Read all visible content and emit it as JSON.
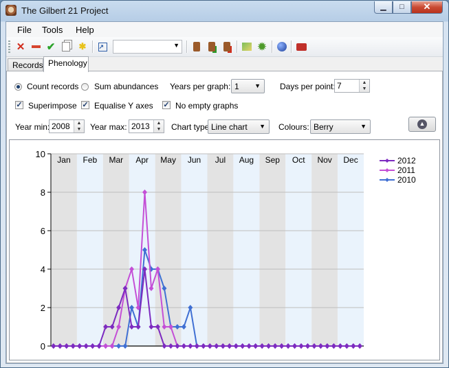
{
  "window": {
    "title": "The Gilbert 21 Project"
  },
  "menu": [
    "File",
    "Tools",
    "Help"
  ],
  "tabs": [
    {
      "label": "Records",
      "active": false
    },
    {
      "label": "Phenology",
      "active": true
    }
  ],
  "options": {
    "radios": [
      {
        "label": "Count records",
        "checked": true
      },
      {
        "label": "Sum abundances",
        "checked": false
      }
    ],
    "years_per_graph_label": "Years per graph:",
    "years_per_graph": "1",
    "days_per_point_label": "Days per point:",
    "days_per_point": "7",
    "checkboxes": [
      {
        "label": "Superimpose",
        "checked": true
      },
      {
        "label": "Equalise Y axes",
        "checked": true
      },
      {
        "label": "No empty graphs",
        "checked": true
      }
    ],
    "year_min_label": "Year min:",
    "year_min": "2008",
    "year_max_label": "Year max:",
    "year_max": "2013",
    "chart_type_label": "Chart type:",
    "chart_type": "Line chart",
    "colours_label": "Colours:",
    "colours": "Berry"
  },
  "chart_data": {
    "type": "line",
    "categories": [
      "Jan",
      "Feb",
      "Mar",
      "Apr",
      "May",
      "Jun",
      "Jul",
      "Aug",
      "Sep",
      "Oct",
      "Nov",
      "Dec"
    ],
    "ylim": [
      0,
      10
    ],
    "yticks": [
      0,
      2,
      4,
      6,
      8,
      10
    ],
    "xlim": [
      0,
      12
    ],
    "legend_position": "top-right",
    "series": [
      {
        "name": "2012",
        "color": "#7d2bc0",
        "points": [
          [
            0.1,
            0
          ],
          [
            0.35,
            0
          ],
          [
            0.6,
            0
          ],
          [
            0.85,
            0
          ],
          [
            1.1,
            0
          ],
          [
            1.35,
            0
          ],
          [
            1.6,
            0
          ],
          [
            1.85,
            0
          ],
          [
            2.1,
            1
          ],
          [
            2.35,
            1
          ],
          [
            2.6,
            2
          ],
          [
            2.85,
            3
          ],
          [
            3.1,
            1
          ],
          [
            3.35,
            1
          ],
          [
            3.6,
            4
          ],
          [
            3.85,
            1
          ],
          [
            4.1,
            1
          ],
          [
            4.35,
            0
          ],
          [
            4.6,
            0
          ],
          [
            4.85,
            0
          ],
          [
            5.1,
            0
          ],
          [
            5.35,
            0
          ],
          [
            5.6,
            0
          ],
          [
            5.85,
            0
          ],
          [
            6.1,
            0
          ],
          [
            6.35,
            0
          ],
          [
            6.6,
            0
          ],
          [
            6.85,
            0
          ],
          [
            7.1,
            0
          ],
          [
            7.35,
            0
          ],
          [
            7.6,
            0
          ],
          [
            7.85,
            0
          ],
          [
            8.1,
            0
          ],
          [
            8.35,
            0
          ],
          [
            8.6,
            0
          ],
          [
            8.85,
            0
          ],
          [
            9.1,
            0
          ],
          [
            9.35,
            0
          ],
          [
            9.6,
            0
          ],
          [
            9.85,
            0
          ],
          [
            10.1,
            0
          ],
          [
            10.35,
            0
          ],
          [
            10.6,
            0
          ],
          [
            10.85,
            0
          ],
          [
            11.1,
            0
          ],
          [
            11.35,
            0
          ],
          [
            11.6,
            0
          ],
          [
            11.85,
            0
          ]
        ]
      },
      {
        "name": "2011",
        "color": "#c44fd6",
        "points": [
          [
            0.1,
            0
          ],
          [
            0.35,
            0
          ],
          [
            0.6,
            0
          ],
          [
            0.85,
            0
          ],
          [
            1.1,
            0
          ],
          [
            1.35,
            0
          ],
          [
            1.6,
            0
          ],
          [
            1.85,
            0
          ],
          [
            2.1,
            0
          ],
          [
            2.35,
            0
          ],
          [
            2.6,
            1
          ],
          [
            2.85,
            3
          ],
          [
            3.1,
            4
          ],
          [
            3.35,
            2
          ],
          [
            3.6,
            8
          ],
          [
            3.85,
            3
          ],
          [
            4.1,
            4
          ],
          [
            4.35,
            1
          ],
          [
            4.6,
            1
          ],
          [
            4.85,
            0
          ],
          [
            5.1,
            0
          ],
          [
            5.35,
            0
          ],
          [
            5.6,
            0
          ],
          [
            5.85,
            0
          ],
          [
            6.1,
            0
          ],
          [
            6.35,
            0
          ],
          [
            6.6,
            0
          ],
          [
            6.85,
            0
          ],
          [
            7.1,
            0
          ],
          [
            7.35,
            0
          ],
          [
            7.6,
            0
          ],
          [
            7.85,
            0
          ],
          [
            8.1,
            0
          ],
          [
            8.35,
            0
          ],
          [
            8.6,
            0
          ],
          [
            8.85,
            0
          ],
          [
            9.1,
            0
          ],
          [
            9.35,
            0
          ],
          [
            9.6,
            0
          ],
          [
            9.85,
            0
          ],
          [
            10.1,
            0
          ],
          [
            10.35,
            0
          ],
          [
            10.6,
            0
          ],
          [
            10.85,
            0
          ],
          [
            11.1,
            0
          ],
          [
            11.35,
            0
          ],
          [
            11.6,
            0
          ],
          [
            11.85,
            0
          ]
        ]
      },
      {
        "name": "2010",
        "color": "#3f6fd3",
        "points": [
          [
            0.1,
            0
          ],
          [
            0.35,
            0
          ],
          [
            0.6,
            0
          ],
          [
            0.85,
            0
          ],
          [
            1.1,
            0
          ],
          [
            1.35,
            0
          ],
          [
            1.6,
            0
          ],
          [
            1.85,
            0
          ],
          [
            2.1,
            0
          ],
          [
            2.35,
            0
          ],
          [
            2.6,
            0
          ],
          [
            2.85,
            0
          ],
          [
            3.1,
            2
          ],
          [
            3.35,
            1
          ],
          [
            3.6,
            5
          ],
          [
            3.85,
            4
          ],
          [
            4.1,
            4
          ],
          [
            4.35,
            3
          ],
          [
            4.6,
            1
          ],
          [
            4.85,
            1
          ],
          [
            5.1,
            1
          ],
          [
            5.35,
            2
          ],
          [
            5.6,
            0
          ],
          [
            5.85,
            0
          ],
          [
            6.1,
            0
          ],
          [
            6.35,
            0
          ],
          [
            6.6,
            0
          ],
          [
            6.85,
            0
          ],
          [
            7.1,
            0
          ],
          [
            7.35,
            0
          ],
          [
            7.6,
            0
          ],
          [
            7.85,
            0
          ],
          [
            8.1,
            0
          ],
          [
            8.35,
            0
          ],
          [
            8.6,
            0
          ],
          [
            8.85,
            0
          ],
          [
            9.1,
            0
          ],
          [
            9.35,
            0
          ],
          [
            9.6,
            0
          ],
          [
            9.85,
            0
          ],
          [
            10.1,
            0
          ],
          [
            10.35,
            0
          ],
          [
            10.6,
            0
          ],
          [
            10.85,
            0
          ],
          [
            11.1,
            0
          ],
          [
            11.35,
            0
          ],
          [
            11.6,
            0
          ],
          [
            11.85,
            0
          ]
        ]
      }
    ]
  }
}
